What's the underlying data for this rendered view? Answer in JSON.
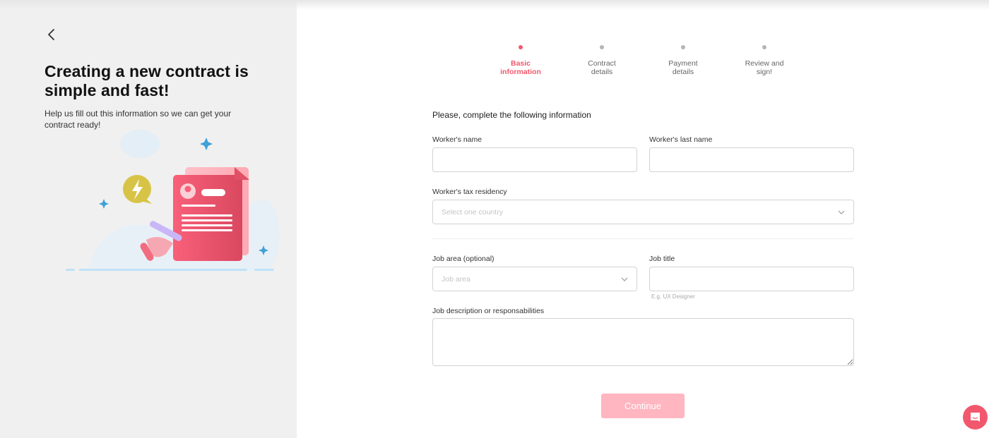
{
  "sidebar": {
    "back_icon": "chevron-left-icon",
    "title": "Creating a new contract is simple and fast!",
    "subtitle": "Help us fill out this information so we can get your contract ready!",
    "illustration": "contract-document-illustration"
  },
  "stepper": {
    "steps": [
      {
        "label_line1": "Basic",
        "label_line2": "information",
        "active": true
      },
      {
        "label_line1": "Contract",
        "label_line2": "details",
        "active": false
      },
      {
        "label_line1": "Payment",
        "label_line2": "details",
        "active": false
      },
      {
        "label_line1": "Review and",
        "label_line2": "sign!",
        "active": false
      }
    ]
  },
  "form": {
    "heading": "Please, complete the following information",
    "first_name": {
      "label": "Worker's name",
      "value": "",
      "placeholder": ""
    },
    "last_name": {
      "label": "Worker's last name",
      "value": "",
      "placeholder": ""
    },
    "tax_residency": {
      "label": "Worker's tax residency",
      "placeholder": "Select one country"
    },
    "job_area": {
      "label": "Job area (optional)",
      "placeholder": "Job area"
    },
    "job_title": {
      "label": "Job title",
      "value": "",
      "hint": "E.g. UX Designer"
    },
    "job_description": {
      "label": "Job description or responsabilities",
      "value": ""
    },
    "continue_label": "Continue"
  },
  "colors": {
    "accent": "#f2586d",
    "button_disabled": "#ffb6c0",
    "sidebar_bg": "#f0f0f0"
  },
  "chat_widget": {
    "icon": "chat-bubble-icon"
  }
}
